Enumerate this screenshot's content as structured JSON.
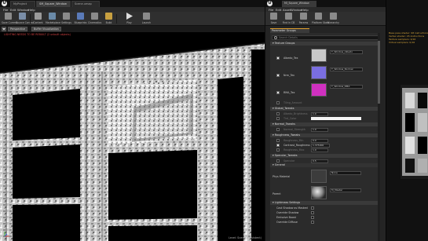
{
  "main_window": {
    "logo": "U",
    "tabs": [
      "MyProject",
      "SM_Square_Window",
      "Scene.umap"
    ],
    "menu": [
      "File",
      "Edit",
      "Window",
      "Help"
    ],
    "toolbar": [
      {
        "label": "Save Current",
        "icon": "save-icon",
        "color": "#8a8a8a"
      },
      {
        "label": "Source Control",
        "icon": "source-control-icon",
        "color": "#7a8ea8"
      },
      {
        "label": "Content",
        "icon": "content-browser-icon",
        "color": "#9a9a9a"
      },
      {
        "label": "Marketplace",
        "icon": "marketplace-icon",
        "color": "#6a8aa8"
      },
      {
        "label": "Settings",
        "icon": "settings-icon",
        "color": "#8a8a8a"
      },
      {
        "label": "Blueprints",
        "icon": "blueprints-icon",
        "color": "#5a7ab8"
      },
      {
        "label": "Cinematics",
        "icon": "cinematics-icon",
        "color": "#8a8a8a"
      },
      {
        "label": "Build",
        "icon": "build-icon",
        "color": "#c8a040"
      },
      {
        "label": "Play",
        "icon": "play-icon",
        "color": "#dddddd"
      },
      {
        "label": "Launch",
        "icon": "launch-icon",
        "color": "#8a8a8a"
      }
    ],
    "viewport": {
      "perspective_label": "Perspective",
      "view_mode_label": "Buffer Visualization",
      "notice": "LIGHTING NEEDS TO BE REBUILT (2 unbuilt objects)",
      "footer": "Level: Scene (Persistent)"
    }
  },
  "material_window": {
    "logo": "U",
    "tab_title": "MI_Square_Window",
    "menu": [
      "File",
      "Edit",
      "Asset",
      "Window",
      "Help"
    ],
    "toolbar": [
      {
        "label": "Save",
        "icon": "save-icon",
        "color": "#8a8a8a"
      },
      {
        "label": "Find in CB",
        "icon": "find-in-browser-icon",
        "color": "#8a8a8a"
      },
      {
        "label": "Params",
        "icon": "params-icon",
        "color": "#8a8a8a"
      },
      {
        "label": "Platform Stats",
        "icon": "platform-stats-icon",
        "color": "#8a8a8a"
      },
      {
        "label": "Hierarchy",
        "icon": "hierarchy-icon",
        "color": "#8a8a8a"
      }
    ],
    "panel_tab": "Parameter Groups",
    "search_placeholder": "Search Details",
    "sections": {
      "texture_groups": "Texture Groups",
      "global_tweaks": "Global_Tweaks",
      "normal_tweaks": "Normal_Tweaks",
      "roughness_tweaks": "Roughness_Tweaks",
      "specular_tweaks": "Specular_Tweaks",
      "general": "General",
      "lightmass": "Lightmass Settings"
    },
    "textures": [
      {
        "name": "Albedo_Tex",
        "value": "T_Window_Albedo",
        "checked": true
      },
      {
        "name": "Nrm_Tex",
        "value": "T_Window_Normal",
        "checked": true
      },
      {
        "name": "RMA_Tex",
        "value": "T_Window_RMA",
        "checked": true
      }
    ],
    "texture_ops": {
      "label": "Tiling_Amount",
      "value": "1.0"
    },
    "global_rows": [
      {
        "label": "Albedo_Brightness",
        "value": "1.0"
      },
      {
        "label": "Tint_Color",
        "value": ""
      }
    ],
    "normal_rows": [
      {
        "label": "Normal_Strength",
        "value": "1.0"
      }
    ],
    "roughness_rows": [
      {
        "label": "Roughness_Min",
        "value": "0.0"
      },
      {
        "label": "Contrast_Roughness",
        "value": "1.375000"
      },
      {
        "label": "Roughness_Max",
        "value": "1.0"
      }
    ],
    "specular_rows": [
      {
        "label": "Specular",
        "value": "0.5"
      }
    ],
    "general": {
      "parent_material_label": "Phys Material",
      "parent_material_value": "None",
      "parent_label": "Parent",
      "parent_value": "M_Master"
    },
    "lightmass": [
      {
        "label": "Cast Shadow as Masked",
        "checked": false
      },
      {
        "label": "Override Shadow",
        "checked": false
      },
      {
        "label": "Emissive Boost",
        "checked": false
      },
      {
        "label": "Override Diffuse",
        "checked": false
      }
    ]
  },
  "right_window": {
    "stats": [
      "Base pass shader: 98 instructions",
      "Vertex shader: 45 instructions",
      "Texture samplers: 4/16",
      "Virtual samplers: 0/16"
    ]
  }
}
